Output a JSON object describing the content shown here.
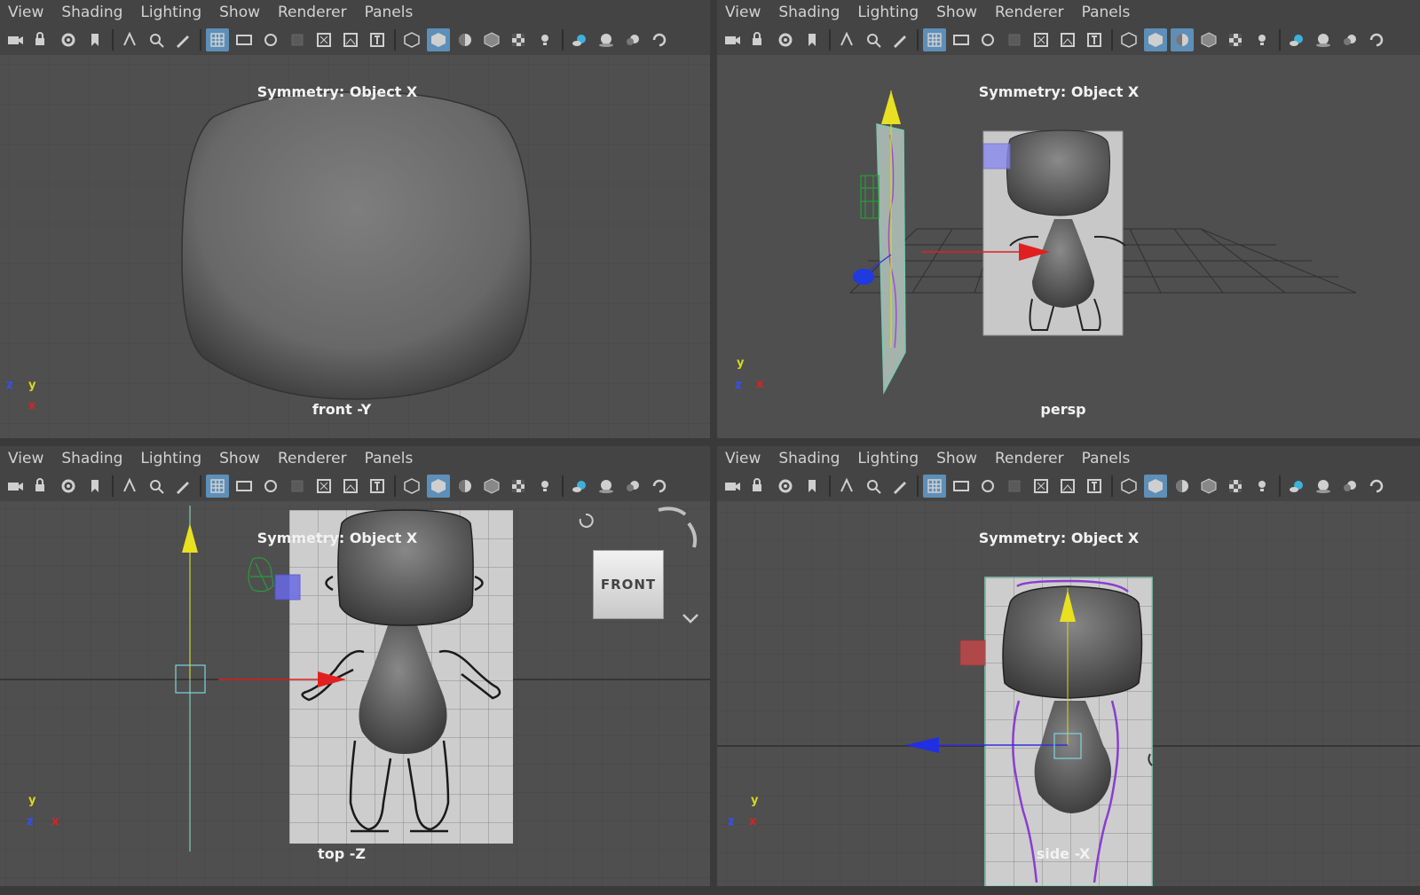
{
  "menus": [
    "View",
    "Shading",
    "Lighting",
    "Show",
    "Renderer",
    "Panels"
  ],
  "toolbar_icons": [
    "camera-icon",
    "camera-lock-icon",
    "camera-attributes-icon",
    "bookmark-icon",
    "image-plane-icon",
    "2d-pan-zoom-icon",
    "grease-pencil-icon",
    "grid-icon",
    "film-gate-icon",
    "resolution-gate-icon",
    "gate-mask-icon",
    "field-chart-icon",
    "safe-action-icon",
    "safe-title-icon",
    "wireframe-icon",
    "smooth-shade-icon",
    "default-material-icon",
    "wireframe-on-shaded-icon",
    "textured-icon",
    "use-all-lights-icon",
    "shadows-icon",
    "screen-space-ao-icon",
    "motion-blur-icon",
    "anti-aliasing-icon"
  ],
  "symmetry_label": "Symmetry: Object X",
  "panels": {
    "front": {
      "camera": "front -Y",
      "axes": [
        "z",
        "y",
        "x"
      ]
    },
    "persp": {
      "camera": "persp",
      "axes": [
        "y",
        "z",
        "x"
      ]
    },
    "top": {
      "camera": "top -Z",
      "axes": [
        "y",
        "z",
        "x"
      ]
    },
    "side": {
      "camera": "side -X",
      "axes": [
        "y",
        "z",
        "x"
      ]
    }
  },
  "viewcube_label": "FRONT",
  "colors": {
    "selected_icon": "#5d8fb8",
    "x_axis": "#e02020",
    "y_axis": "#e8e020",
    "z_axis": "#2030e0",
    "mesh": "#777777",
    "background": "#4f4f4f"
  }
}
